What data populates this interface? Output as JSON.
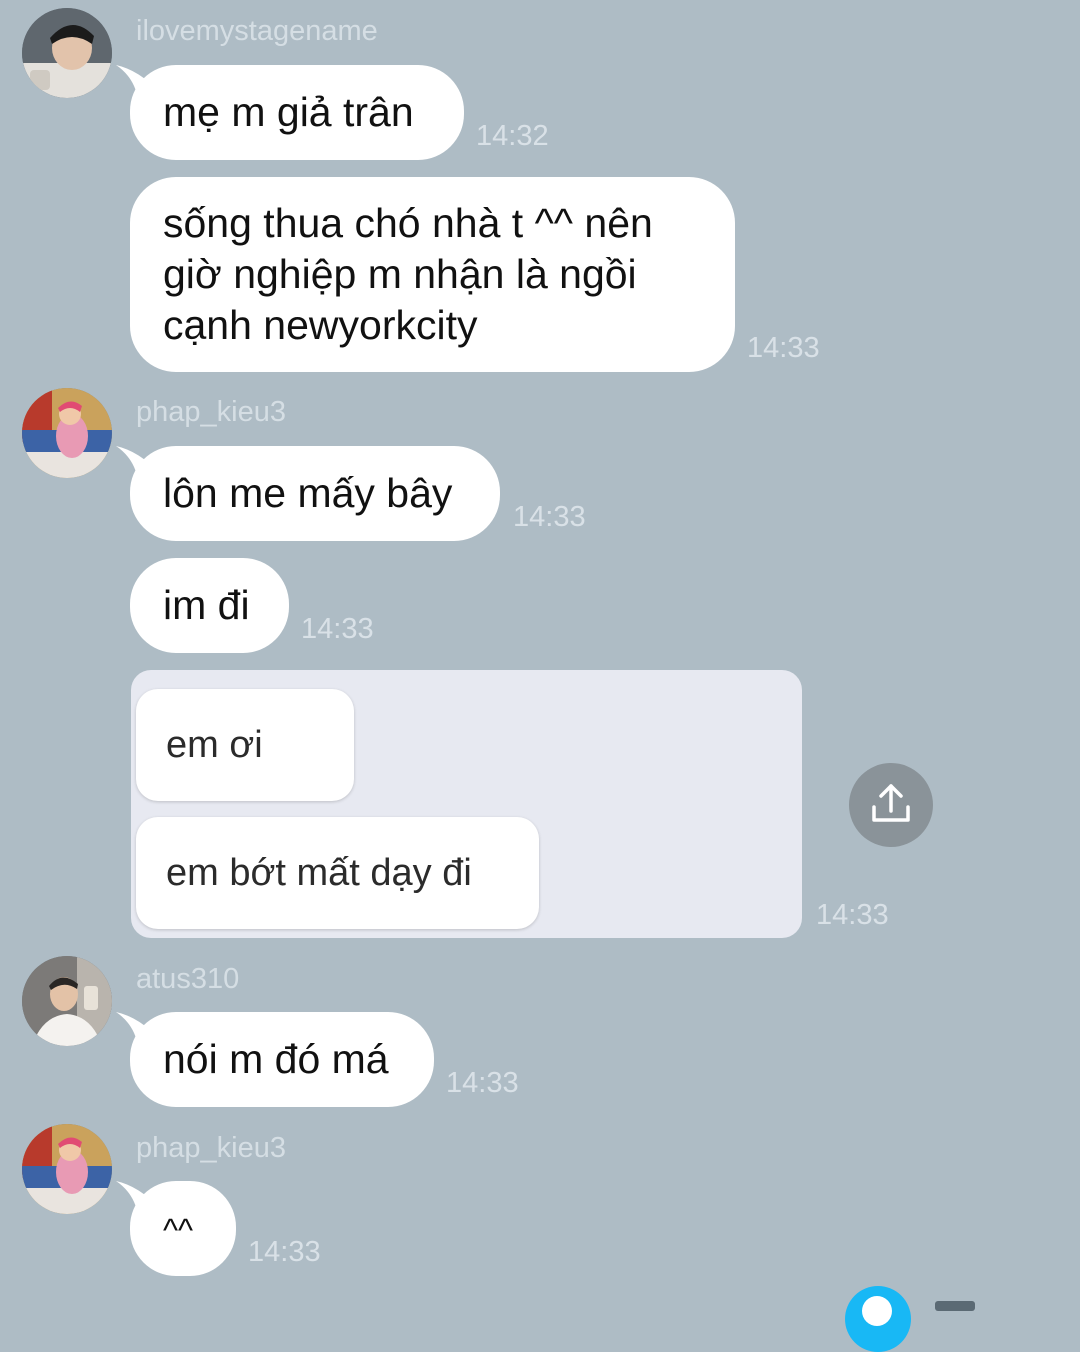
{
  "messages": [
    {
      "username": "ilovemystagename",
      "bubbles": [
        {
          "text": "mẹ m giả trân",
          "time": "14:32"
        },
        {
          "text": "sống thua chó nhà t ^^ nên giờ nghiệp m nhận là ngồi cạnh newyorkcity",
          "time": "14:33"
        }
      ]
    },
    {
      "username": "phap_kieu3",
      "bubbles": [
        {
          "text": "lôn me mấy bây",
          "time": "14:33"
        },
        {
          "text": "im đi",
          "time": "14:33"
        }
      ],
      "photo": {
        "lines": [
          "em ơi",
          "em bớt mất dạy đi"
        ],
        "time": "14:33"
      }
    },
    {
      "username": "atus310",
      "bubbles": [
        {
          "text": "nói m đó má",
          "time": "14:33"
        }
      ]
    },
    {
      "username": "phap_kieu3",
      "bubbles": [
        {
          "text": "^^",
          "time": "14:33"
        }
      ]
    }
  ],
  "icons": {
    "share": "share-upload-icon"
  },
  "colors": {
    "background": "#aebcc5",
    "bubble": "#ffffff",
    "photo_background": "#e7e9f1",
    "share_button": "#8a9399"
  }
}
